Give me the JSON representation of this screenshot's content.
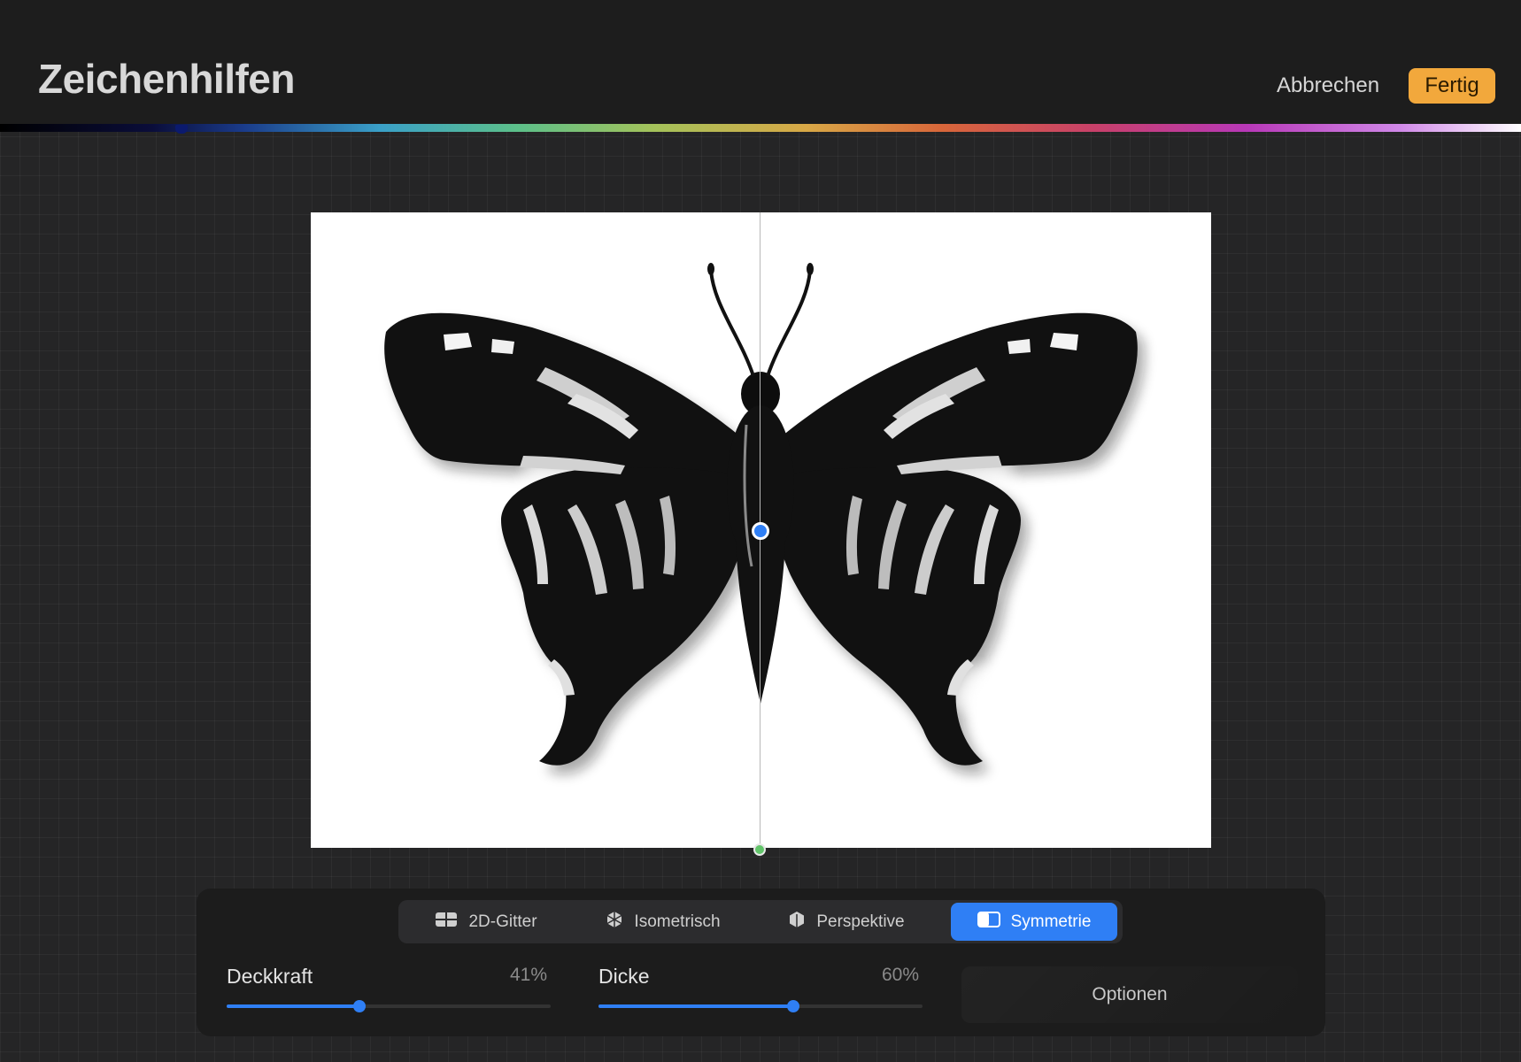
{
  "header": {
    "title": "Zeichenhilfen",
    "cancel_label": "Abbrechen",
    "done_label": "Fertig"
  },
  "colors": {
    "accent": "#2f7ff5",
    "done_button": "#f2a83c",
    "background": "#252526"
  },
  "canvas": {
    "subject": "butterfly-illustration",
    "guide": "vertical-symmetry-line"
  },
  "modes": [
    {
      "label": "2D-Gitter",
      "icon": "grid-2d-icon",
      "active": false
    },
    {
      "label": "Isometrisch",
      "icon": "cube-isometric-icon",
      "active": false
    },
    {
      "label": "Perspektive",
      "icon": "hexagon-perspective-icon",
      "active": false
    },
    {
      "label": "Symmetrie",
      "icon": "symmetry-icon",
      "active": true
    }
  ],
  "sliders": {
    "opacity": {
      "label": "Deckkraft",
      "value_text": "41%",
      "value": 0.41
    },
    "thickness": {
      "label": "Dicke",
      "value_text": "60%",
      "value": 0.6
    }
  },
  "options_label": "Optionen"
}
